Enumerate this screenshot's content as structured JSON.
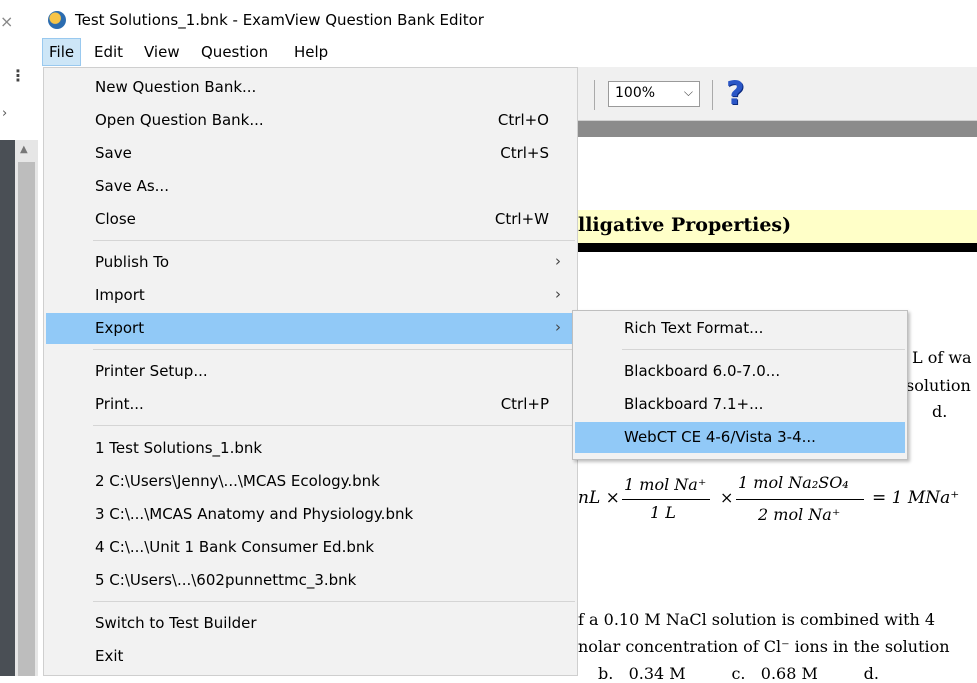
{
  "window": {
    "title": "Test Solutions_1.bnk - ExamView Question Bank Editor"
  },
  "menubar": [
    "File",
    "Edit",
    "View",
    "Question",
    "Help"
  ],
  "toolbar": {
    "zoom_value": "100%"
  },
  "document": {
    "heading": "lligative Properties)",
    "frag1": "L of wa",
    "frag2": "solution",
    "frag3": "d.",
    "eq_left": "nL ×",
    "eq_num1": "1 mol Na⁺",
    "eq_den1": "1 L",
    "eq_times": "×",
    "eq_num2": "1 mol Na₂SO₄",
    "eq_den2": "2 mol Na⁺",
    "eq_result": "= 1 MNa⁺",
    "line1": "f a 0.10 M NaCl solution is combined with 4",
    "line2": "nolar concentration of Cl⁻ ions in the solution",
    "line3": "b.   0.34 M         c.   0.68 M         d."
  },
  "file_menu": {
    "items": [
      {
        "label": "New Question Bank...",
        "shortcut": ""
      },
      {
        "label": "Open Question Bank...",
        "shortcut": "Ctrl+O"
      },
      {
        "label": "Save",
        "shortcut": "Ctrl+S"
      },
      {
        "label": "Save As...",
        "shortcut": ""
      },
      {
        "label": "Close",
        "shortcut": "Ctrl+W"
      },
      {
        "label": "Publish To",
        "shortcut": ""
      },
      {
        "label": "Import",
        "shortcut": ""
      },
      {
        "label": "Export",
        "shortcut": ""
      },
      {
        "label": "Printer Setup...",
        "shortcut": ""
      },
      {
        "label": "Print...",
        "shortcut": "Ctrl+P"
      },
      {
        "label": "1 Test Solutions_1.bnk",
        "shortcut": ""
      },
      {
        "label": "2 C:\\Users\\Jenny\\...\\MCAS Ecology.bnk",
        "shortcut": ""
      },
      {
        "label": "3 C:\\...\\MCAS Anatomy and Physiology.bnk",
        "shortcut": ""
      },
      {
        "label": "4 C:\\...\\Unit 1 Bank Consumer Ed.bnk",
        "shortcut": ""
      },
      {
        "label": "5 C:\\Users\\...\\602punnettmc_3.bnk",
        "shortcut": ""
      },
      {
        "label": "Switch to Test Builder",
        "shortcut": ""
      },
      {
        "label": "Exit",
        "shortcut": ""
      }
    ]
  },
  "export_submenu": {
    "items": [
      {
        "label": "Rich Text Format..."
      },
      {
        "label": "Blackboard 6.0-7.0..."
      },
      {
        "label": "Blackboard 7.1+..."
      },
      {
        "label": "WebCT CE 4-6/Vista 3-4..."
      }
    ]
  }
}
